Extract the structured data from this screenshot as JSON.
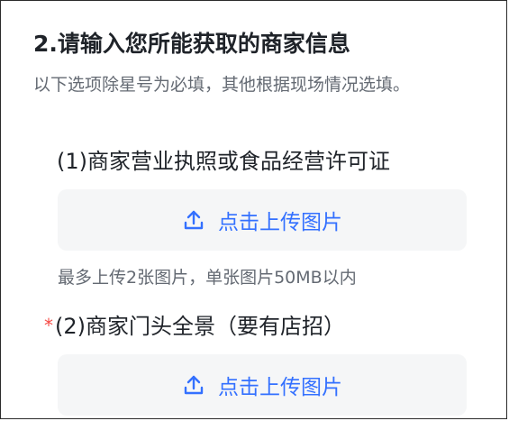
{
  "section": {
    "title": "2.请输入您所能获取的商家信息",
    "description": "以下选项除星号为必填，其他根据现场情况选填。"
  },
  "fields": [
    {
      "label": "(1)商家营业执照或食品经营许可证",
      "required": false,
      "upload_label": "点击上传图片",
      "hint": "最多上传2张图片，单张图片50MB以内"
    },
    {
      "label": "(2)商家门头全景（要有店招）",
      "required": true,
      "required_mark": "*",
      "upload_label": "点击上传图片"
    }
  ],
  "colors": {
    "accent": "#3370ff",
    "required": "#f54a45",
    "upload_bg": "#f5f6f7",
    "muted_text": "#646a73"
  },
  "icons": {
    "upload": "upload-icon"
  }
}
